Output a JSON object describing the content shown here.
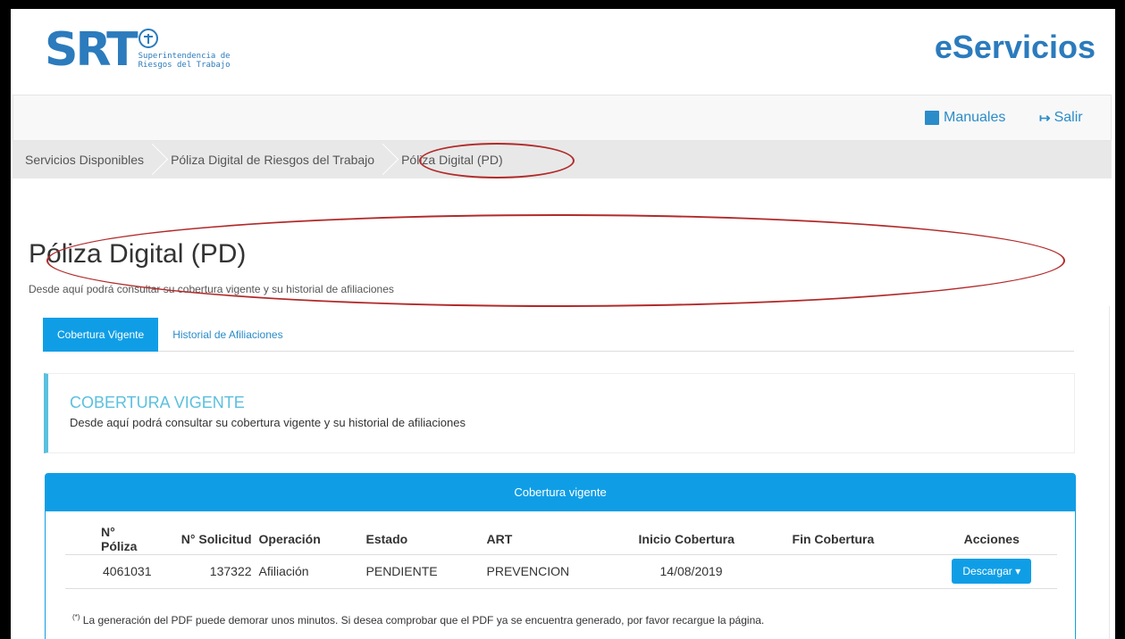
{
  "header": {
    "logo_text": "SRT",
    "logo_subtitle_1": "Superintendencia de",
    "logo_subtitle_2": "Riesgos del Trabajo",
    "brand": "eServicios"
  },
  "topbar": {
    "manuales_label": "Manuales",
    "salir_label": "Salir"
  },
  "breadcrumb": [
    "Servicios Disponibles",
    "Póliza Digital de Riesgos del Trabajo",
    "Póliza Digital (PD)"
  ],
  "page": {
    "title": "Póliza Digital (PD)",
    "subtitle": "Desde aquí podrá consultar su cobertura vigente y su historial de afiliaciones"
  },
  "tabs": [
    {
      "label": "Cobertura Vigente",
      "active": true
    },
    {
      "label": "Historial de Afiliaciones",
      "active": false
    }
  ],
  "callout": {
    "title": "COBERTURA VIGENTE",
    "text": "Desde aquí podrá consultar su cobertura vigente y su historial de afiliaciones"
  },
  "card": {
    "header": "Cobertura vigente",
    "columns": [
      "N° Póliza",
      "N° Solicitud",
      "Operación",
      "Estado",
      "ART",
      "Inicio Cobertura",
      "Fin Cobertura",
      "Acciones"
    ],
    "rows": [
      {
        "poliza": "4061031",
        "solicitud": "137322",
        "operacion": "Afiliación",
        "estado": "PENDIENTE",
        "art": "PREVENCION",
        "inicio": "14/08/2019",
        "fin": "",
        "accion": "Descargar"
      }
    ],
    "note_mark": "(*)",
    "note": "La generación del PDF puede demorar unos minutos. Si desea comprobar que el PDF ya se encuentra generado, por favor recargue la página."
  },
  "colors": {
    "brand_blue": "#2b7bbd",
    "primary": "#0f9ee6",
    "info": "#5bc0de",
    "annotation_red": "#b22a2a"
  }
}
